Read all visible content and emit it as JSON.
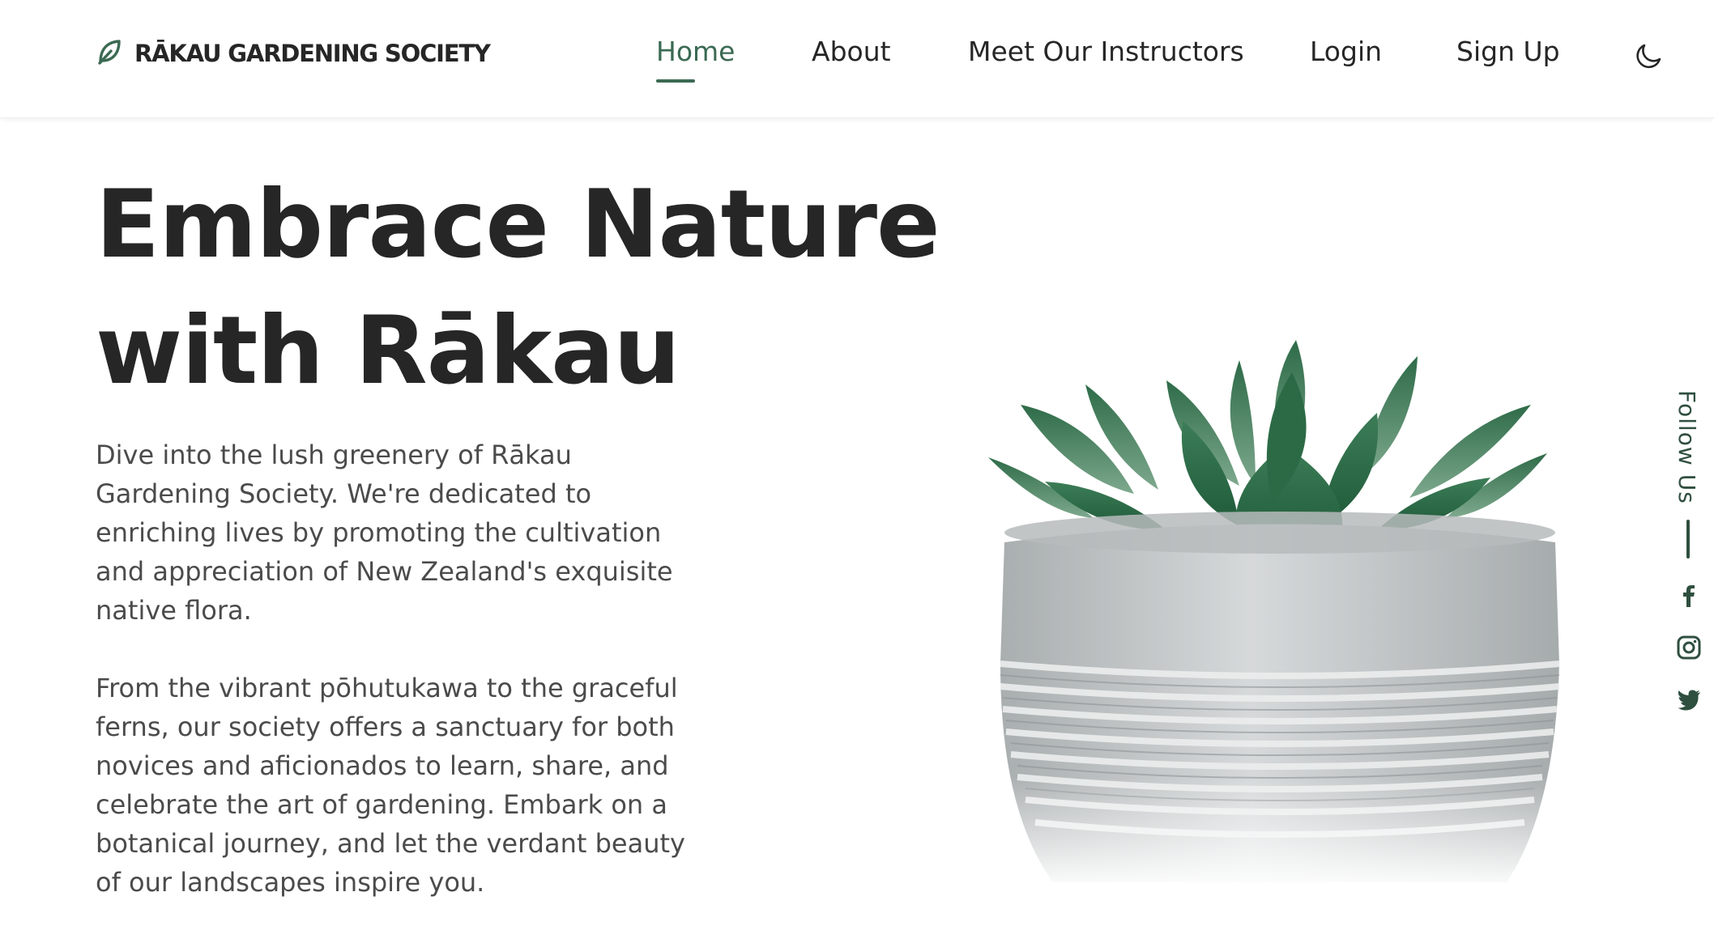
{
  "brand": {
    "name": "RĀKAU GARDENING SOCIETY",
    "logo_icon": "leaf-icon"
  },
  "nav": {
    "items": [
      {
        "label": "Home",
        "active": true
      },
      {
        "label": "About",
        "active": false
      },
      {
        "label": "Meet Our Instructors",
        "active": false
      },
      {
        "label": "Login",
        "active": false
      },
      {
        "label": "Sign Up",
        "active": false
      }
    ],
    "theme_toggle_icon": "moon-icon"
  },
  "hero": {
    "title_line1": "Embrace Nature",
    "title_line2": "with Rākau",
    "paragraph1": "Dive into the lush greenery of Rākau Gardening Society. We're dedicated to enriching lives by promoting the cultivation and appreciation of New Zealand's exquisite native flora.",
    "paragraph2": "From the vibrant pōhutukawa to the graceful ferns, our society offers a sanctuary for both novices and aficionados to learn, share, and celebrate the art of gardening. Embark on a botanical journey, and let the verdant beauty of our landscapes inspire you.",
    "image": "succulent-in-concrete-pot"
  },
  "social": {
    "label": "Follow Us",
    "icons": [
      "facebook-icon",
      "instagram-icon",
      "twitter-icon"
    ]
  },
  "colors": {
    "accent": "#3b6a53",
    "text": "#262626",
    "body_text": "#4b4b4b",
    "social": "#2f4f3f"
  }
}
